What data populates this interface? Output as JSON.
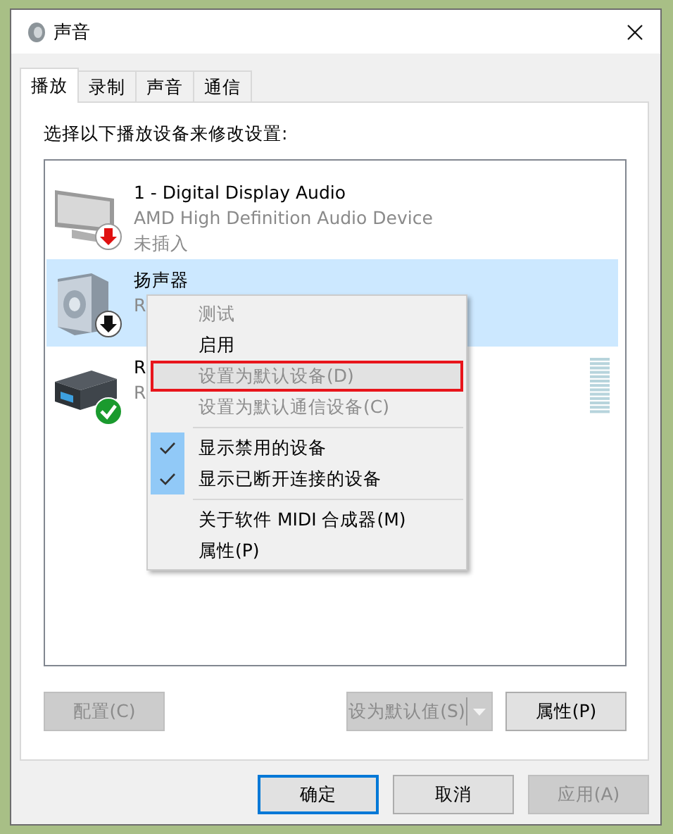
{
  "window": {
    "title": "声音"
  },
  "tabs": [
    {
      "label": "播放",
      "selected": true
    },
    {
      "label": "录制",
      "selected": false
    },
    {
      "label": "声音",
      "selected": false
    },
    {
      "label": "通信",
      "selected": false
    }
  ],
  "instruction": "选择以下播放设备来修改设置:",
  "devices": [
    {
      "kind": "monitor",
      "plugged_in": false,
      "enabled": true,
      "is_default": false,
      "selected": false,
      "name": "1 - Digital Display Audio",
      "detail": "AMD High Definition Audio Device",
      "state_text": "未插入"
    },
    {
      "kind": "speaker",
      "plugged_in": true,
      "enabled": false,
      "is_default": false,
      "selected": true,
      "name": "扬声器",
      "detail": "R"
    },
    {
      "kind": "receiver",
      "plugged_in": true,
      "enabled": true,
      "is_default": true,
      "selected": false,
      "name": "R",
      "detail": "R"
    }
  ],
  "context_menu": [
    {
      "kind": "item",
      "label": "测试",
      "disabled": true,
      "checked": false,
      "hovered": false,
      "outlined": false
    },
    {
      "kind": "item",
      "label": "启用",
      "disabled": false,
      "checked": false,
      "hovered": false,
      "outlined": false
    },
    {
      "kind": "item",
      "label": "设置为默认设备(D)",
      "disabled": true,
      "checked": false,
      "hovered": true,
      "outlined": true
    },
    {
      "kind": "item",
      "label": "设置为默认通信设备(C)",
      "disabled": true,
      "checked": false,
      "hovered": false,
      "outlined": false
    },
    {
      "kind": "separator"
    },
    {
      "kind": "item",
      "label": "显示禁用的设备",
      "disabled": false,
      "checked": true,
      "hovered": false,
      "outlined": false
    },
    {
      "kind": "item",
      "label": "显示已断开连接的设备",
      "disabled": false,
      "checked": true,
      "hovered": false,
      "outlined": false
    },
    {
      "kind": "separator"
    },
    {
      "kind": "item",
      "label": "关于软件 MIDI 合成器(M)",
      "disabled": false,
      "checked": false,
      "hovered": false,
      "outlined": false
    },
    {
      "kind": "item",
      "label": "属性(P)",
      "disabled": false,
      "checked": false,
      "hovered": false,
      "outlined": false
    }
  ],
  "panel_buttons": [
    {
      "kind": "plain",
      "label": "配置(C)",
      "disabled": true
    },
    {
      "kind": "split",
      "label": "设为默认值(S)",
      "disabled": true
    },
    {
      "kind": "plain",
      "label": "属性(P)",
      "disabled": false
    }
  ],
  "dialog_buttons": [
    {
      "label": "确定",
      "disabled": false,
      "default": true
    },
    {
      "label": "取消",
      "disabled": false,
      "default": false
    },
    {
      "label": "应用(A)",
      "disabled": true,
      "default": false
    }
  ]
}
